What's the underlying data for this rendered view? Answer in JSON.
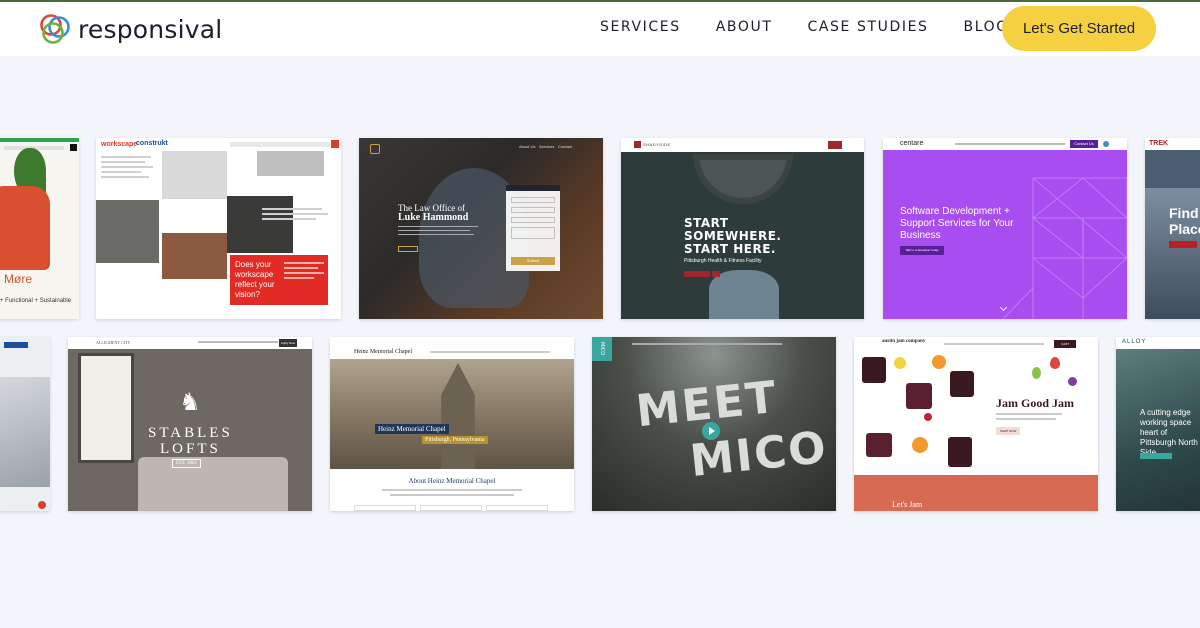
{
  "header": {
    "brand": "responsival",
    "nav": [
      "SERVICES",
      "ABOUT",
      "CASE STUDIES",
      "BLOG"
    ],
    "cta": "Let's Get Started"
  },
  "colors": {
    "accent": "#f5d142",
    "background": "#f3f5fb",
    "text": "#1b1e2b"
  },
  "row1": {
    "grocery": {
      "word": "Møre",
      "tagline": "+ Functional + Sustainable"
    },
    "workscape": {
      "brand": "workscape",
      "partner": "construkt",
      "headline": "Does your workscape reflect your vision?"
    },
    "law": {
      "nav": [
        "About Us",
        "Services",
        "Contact"
      ],
      "pre": "The Law Office of",
      "name": "Luke Hammond",
      "form_button": "Submit"
    },
    "gym": {
      "brand": "SHADYSIDE",
      "headline": "START SOMEWHERE. START HERE.",
      "sub": "Pittsburgh Health & Fitness Facility"
    },
    "centare": {
      "brand": "centare",
      "headline": "Software Development + Support Services for Your Business",
      "button": "Talk to a developer today",
      "nav_button": "Contact Us"
    },
    "trek": {
      "brand": "TREK",
      "headline": "Find Place"
    }
  },
  "row2": {
    "stables": {
      "line1": "STABLES",
      "line2": "LOFTS",
      "est": "EST. 1882",
      "top": "ALLEGHENY CITY",
      "nav_button": "Apply Now"
    },
    "heinz": {
      "header": "Heinz Memorial Chapel",
      "badge": "Heinz Memorial Chapel",
      "sub": "Pittsburgh, Pennsylvania",
      "title": "About Heinz Memorial Chapel"
    },
    "mico": {
      "tag": "MICO",
      "line1": "MEET",
      "line2": "MICO"
    },
    "jam": {
      "brand": "austin jam company",
      "headline": "Jam Good Jam",
      "button": "SHOP NOW",
      "footer": "Let's Jam",
      "nav_button": "CART"
    },
    "alloy": {
      "brand": "ALLOY",
      "text": "A cutting edge working space heart of Pittsburgh North Side"
    }
  }
}
